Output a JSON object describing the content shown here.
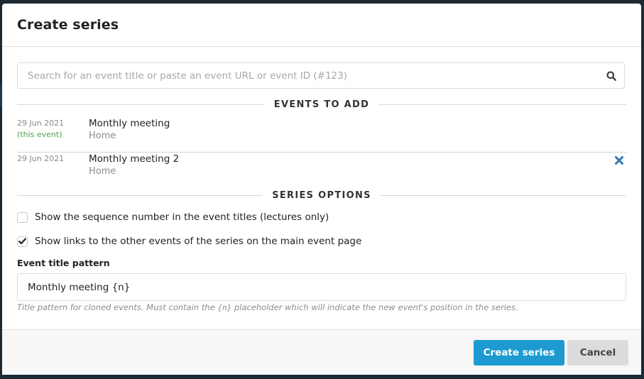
{
  "modal": {
    "title": "Create series"
  },
  "search": {
    "placeholder": "Search for an event title or paste an event URL or event ID (#123)",
    "value": ""
  },
  "events_section": {
    "heading": "EVENTS TO ADD",
    "events": [
      {
        "date": "29 Jun 2021",
        "note": "(this event)",
        "title": "Monthly meeting",
        "category": "Home",
        "removable": false
      },
      {
        "date": "29 Jun 2021",
        "note": "",
        "title": "Monthly meeting 2",
        "category": "Home",
        "removable": true
      }
    ]
  },
  "options_section": {
    "heading": "SERIES OPTIONS",
    "options": [
      {
        "label": "Show the sequence number in the event titles (lectures only)",
        "checked": false
      },
      {
        "label": "Show links to the other events of the series on the main event page",
        "checked": true
      }
    ]
  },
  "title_pattern": {
    "label": "Event title pattern",
    "value": "Monthly meeting {n}",
    "hint_before": "Title pattern for cloned events. Must contain the ",
    "hint_code": "{n}",
    "hint_after": " placeholder which will indicate the new event's position in the series."
  },
  "actions": {
    "submit_label": "Create series",
    "cancel_label": "Cancel"
  },
  "colors": {
    "primary": "#1d9bd1",
    "remove_icon": "#2f75b8",
    "this_event_note": "#4ea24e"
  },
  "icons": [
    "search-icon",
    "remove-icon",
    "checkmark-icon"
  ]
}
